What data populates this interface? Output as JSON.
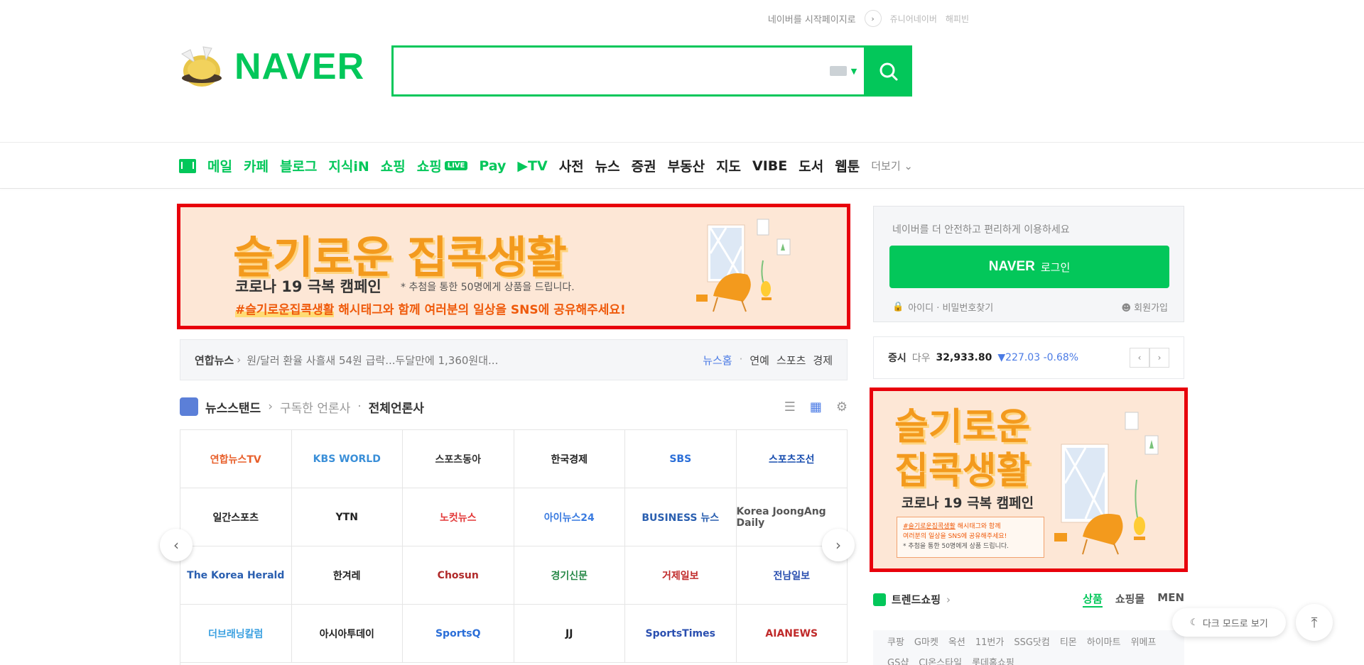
{
  "top_util": {
    "start_page": "네이버를 시작페이지로",
    "link1": "쥬니어네이버",
    "link2": "해피빈"
  },
  "header": {
    "logo": "NAVER",
    "search_placeholder": ""
  },
  "nav": {
    "items": [
      {
        "label": "메일",
        "color": "green"
      },
      {
        "label": "카페",
        "color": "green"
      },
      {
        "label": "블로그",
        "color": "green"
      },
      {
        "label": "지식iN",
        "color": "green"
      },
      {
        "label": "쇼핑",
        "color": "green"
      },
      {
        "label": "쇼핑",
        "badge": "LIVE",
        "color": "green"
      },
      {
        "label": "Pay",
        "color": "green"
      },
      {
        "label": "▶TV",
        "color": "green"
      },
      {
        "label": "사전",
        "color": "dark"
      },
      {
        "label": "뉴스",
        "color": "dark"
      },
      {
        "label": "증권",
        "color": "dark"
      },
      {
        "label": "부동산",
        "color": "dark"
      },
      {
        "label": "지도",
        "color": "dark"
      },
      {
        "label": "VIBE",
        "color": "dark"
      },
      {
        "label": "도서",
        "color": "dark"
      },
      {
        "label": "웹툰",
        "color": "dark"
      }
    ],
    "more": "더보기"
  },
  "banner": {
    "title": "슬기로운 집콕생활",
    "subtitle": "코로나 19 극복 캠페인",
    "note": "* 추첨을 통한 50명에게 상품을 드립니다.",
    "hashtag": "#슬기로운집콕생활",
    "tag_text": " 해시태그와 함께 여러분의 일상을 SNS에 공유해주세요!"
  },
  "newsbar": {
    "source": "연합뉴스",
    "headline": "원/달러 환율 사흘새 54원 급락...두달만에 1,360원대...",
    "cats": [
      "뉴스홈",
      "연예",
      "스포츠",
      "경제"
    ]
  },
  "newsstand": {
    "title": "뉴스스탠드",
    "subscribed": "구독한 언론사",
    "all": "전체언론사",
    "press": [
      {
        "name": "연합뉴스TV",
        "color": "#e8602c"
      },
      {
        "name": "KBS WORLD",
        "color": "#3a8fd8"
      },
      {
        "name": "스포츠동아",
        "color": "#333333"
      },
      {
        "name": "한국경제",
        "color": "#222222"
      },
      {
        "name": "SBS",
        "color": "#2a6ed8"
      },
      {
        "name": "스포츠조선",
        "color": "#1b4fb0"
      },
      {
        "name": "일간스포츠",
        "color": "#222222"
      },
      {
        "name": "YTN",
        "color": "#222222"
      },
      {
        "name": "노컷뉴스",
        "color": "#e33a3a"
      },
      {
        "name": "아이뉴스24",
        "color": "#3a7be0"
      },
      {
        "name": "BUSINESS 뉴스",
        "color": "#2a5fb0"
      },
      {
        "name": "Korea JoongAng Daily",
        "color": "#555555"
      },
      {
        "name": "The Korea Herald",
        "color": "#2a5fb0"
      },
      {
        "name": "한겨레",
        "color": "#222222"
      },
      {
        "name": "Chosun",
        "color": "#b02a2a"
      },
      {
        "name": "경기신문",
        "color": "#2a8a4a"
      },
      {
        "name": "거제일보",
        "color": "#c02a2a"
      },
      {
        "name": "전남일보",
        "color": "#2a4fb0"
      },
      {
        "name": "더브래닝칼럼",
        "color": "#3aa0e0"
      },
      {
        "name": "아시아투데이",
        "color": "#222222"
      },
      {
        "name": "SportsQ",
        "color": "#2a6ed8"
      },
      {
        "name": "JJ",
        "color": "#222222"
      },
      {
        "name": "SportsTimes",
        "color": "#2a4fb0"
      },
      {
        "name": "AIANEWS",
        "color": "#c02a2a"
      }
    ]
  },
  "login": {
    "message": "네이버를 더 안전하고 편리하게 이용하세요",
    "button_logo": "NAVER",
    "button_text": "로그인",
    "find": "아이디 · 비밀번호찾기",
    "join": "회원가입"
  },
  "stock": {
    "label": "증시",
    "index": "다우",
    "value": "32,933.80",
    "change": "▼227.03 -0.68%"
  },
  "sidead": {
    "title_line1": "슬기로운",
    "title_line2": "집콕생활",
    "subtitle": "코로나 19 극복 캠페인",
    "box_tag": "#슬기로운집콕생활",
    "box_line1": " 해시태그와 함께",
    "box_line2": "여러분의 일상을 SNS에 공유해주세요!",
    "box_note": "* 추첨을 통한 50명에게 상품 드립니다."
  },
  "trend": {
    "title": "트렌드쇼핑",
    "tabs": [
      "상품",
      "쇼핑몰",
      "MEN"
    ],
    "tags": [
      "쿠팡",
      "G마켓",
      "옥션",
      "11번가",
      "SSG닷컴",
      "티몬",
      "하이마트",
      "위메프",
      "GS샵",
      "CJ온스타일",
      "롯데홈쇼핑"
    ]
  },
  "floating": {
    "dark_mode": "다크 모드로 보기"
  },
  "colors": {
    "brand": "#03c75a",
    "highlight": "#e8000b"
  }
}
